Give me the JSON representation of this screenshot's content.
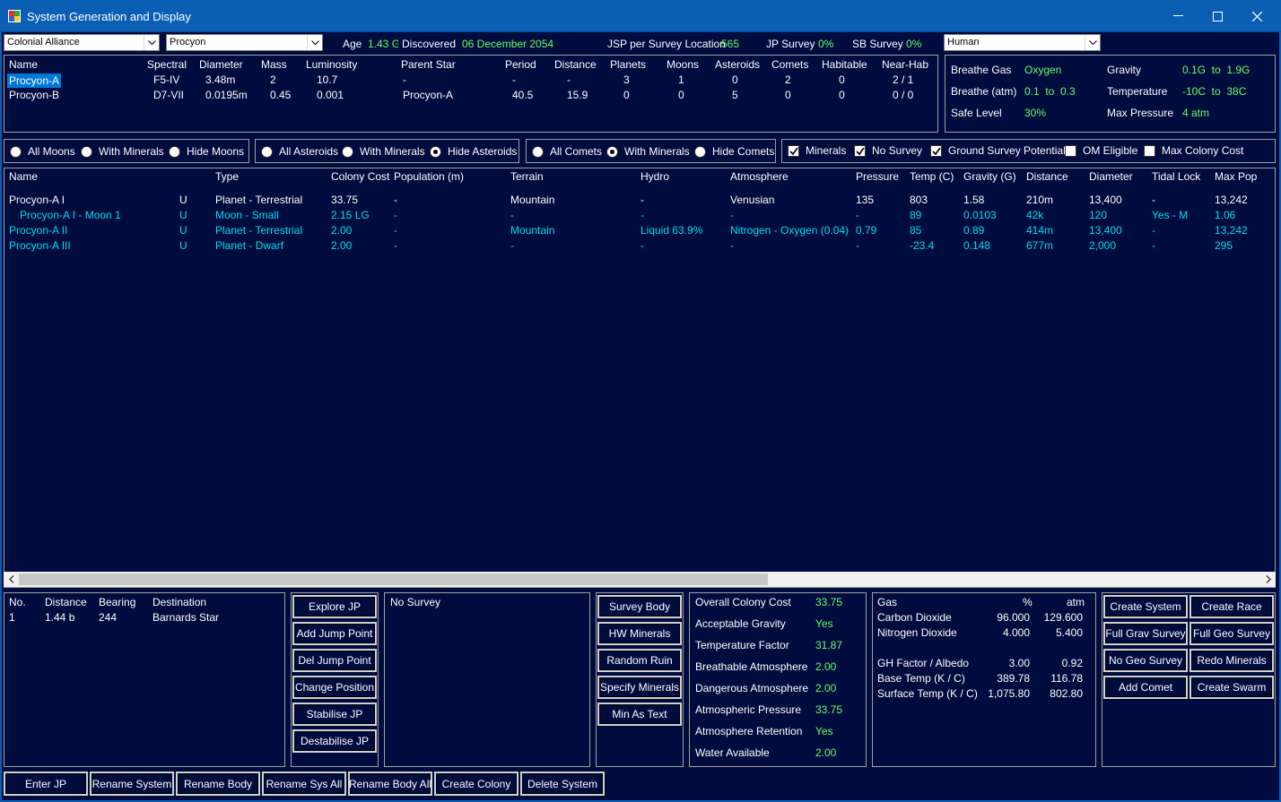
{
  "window": {
    "title": "System Generation and Display"
  },
  "top": {
    "empire": "Colonial Alliance",
    "system": "Procyon",
    "age_label": "Age",
    "age_value": "1.43 G",
    "discovered_label": "Discovered",
    "discovered_value": "06 December 2054",
    "jsp_label": "JSP per Survey Location",
    "jsp_value": "565",
    "jp_survey_label": "JP Survey",
    "jp_survey_value": "0%",
    "sb_survey_label": "SB Survey",
    "sb_survey_value": "0%",
    "race": "Human"
  },
  "stars": {
    "headers": [
      "Name",
      "Spectral",
      "Diameter",
      "Mass",
      "Luminosity",
      "Parent Star",
      "Period",
      "Distance",
      "Planets",
      "Moons",
      "Asteroids",
      "Comets",
      "Habitable",
      "Near-Hab"
    ],
    "rows": [
      [
        "Procyon-A",
        "F5-IV",
        "3.48m",
        "2",
        "10.7",
        "-",
        "-",
        "-",
        "3",
        "1",
        "0",
        "2",
        "0",
        "2 / 1"
      ],
      [
        "Procyon-B",
        "D7-VII",
        "0.0195m",
        "0.45",
        "0.001",
        "Procyon-A",
        "40.5",
        "15.9",
        "0",
        "0",
        "5",
        "0",
        "0",
        "0 / 0"
      ]
    ]
  },
  "env": {
    "breathe_gas_label": "Breathe Gas",
    "breathe_gas_value": "Oxygen",
    "gravity_label": "Gravity",
    "gravity_value": "0.1G  to  1.9G",
    "breathe_atm_label": "Breathe (atm)",
    "breathe_atm_value": "0.1  to  0.3",
    "temperature_label": "Temperature",
    "temperature_value": "-10C  to  38C",
    "safe_level_label": "Safe Level",
    "safe_level_value": "30%",
    "max_pressure_label": "Max Pressure",
    "max_pressure_value": "4 atm"
  },
  "filters": {
    "moons": [
      "All Moons",
      "With Minerals",
      "Hide Moons"
    ],
    "asteroids": [
      "All Asteroids",
      "With Minerals",
      "Hide Asteroids"
    ],
    "comets": [
      "All Comets",
      "With Minerals",
      "Hide Comets"
    ],
    "checks": [
      "Minerals",
      "No Survey",
      "Ground Survey Potential",
      "OM Eligible",
      "Max Colony Cost"
    ]
  },
  "bodies": {
    "headers": [
      "Name",
      "Type",
      "Colony Cost",
      "Population (m)",
      "Terrain",
      "Hydro",
      "Atmosphere",
      "Pressure",
      "Temp (C)",
      "Gravity (G)",
      "Distance",
      "Diameter",
      "Tidal Lock",
      "Max Pop"
    ],
    "rows": [
      {
        "name": "Procyon-A I",
        "flag": "U",
        "type": "Planet - Terrestrial",
        "cost": "33.75",
        "pop": "-",
        "terrain": "Mountain",
        "hydro": "-",
        "atmo": "Venusian",
        "pressure": "135",
        "temp": "803",
        "grav": "1.58",
        "dist": "210m",
        "diam": "13,400",
        "tidal": "-",
        "maxpop": "13,242"
      },
      {
        "name": "Procyon-A I - Moon 1",
        "flag": "U",
        "type": "Moon - Small",
        "cost": "2.15 LG",
        "pop": "-",
        "terrain": "-",
        "hydro": "-",
        "atmo": "-",
        "pressure": "-",
        "temp": "89",
        "grav": "0.0103",
        "dist": "42k",
        "diam": "120",
        "tidal": "Yes - M",
        "maxpop": "1.06"
      },
      {
        "name": "Procyon-A II",
        "flag": "U",
        "type": "Planet - Terrestrial",
        "cost": "2.00",
        "pop": "-",
        "terrain": "Mountain",
        "hydro": "Liquid 63.9%",
        "atmo": "Nitrogen - Oxygen (0.04)",
        "pressure": "0.79",
        "temp": "85",
        "grav": "0.89",
        "dist": "414m",
        "diam": "13,400",
        "tidal": "-",
        "maxpop": "13,242"
      },
      {
        "name": "Procyon-A III",
        "flag": "U",
        "type": "Planet - Dwarf",
        "cost": "2.00",
        "pop": "-",
        "terrain": "-",
        "hydro": "-",
        "atmo": "-",
        "pressure": "-",
        "temp": "-23.4",
        "grav": "0.148",
        "dist": "677m",
        "diam": "2,000",
        "tidal": "-",
        "maxpop": "295"
      }
    ]
  },
  "jump": {
    "headers": [
      "No.",
      "Distance",
      "Bearing",
      "Destination"
    ],
    "rows": [
      [
        "1",
        "1.44 b",
        "244",
        "Barnards Star"
      ]
    ]
  },
  "jp_buttons": [
    "Explore JP",
    "Add Jump Point",
    "Del Jump Point",
    "Change Position",
    "Stabilise JP",
    "Destabilise JP"
  ],
  "survey_status": "No Survey",
  "survey_buttons": [
    "Survey Body",
    "HW Minerals",
    "Random Ruin",
    "Specify Minerals",
    "Min As Text"
  ],
  "colony_cost": [
    {
      "label": "Overall Colony Cost",
      "value": "33.75"
    },
    {
      "label": "Acceptable Gravity",
      "value": "Yes"
    },
    {
      "label": "Temperature Factor",
      "value": "31.87"
    },
    {
      "label": "Breathable Atmosphere",
      "value": "2.00"
    },
    {
      "label": "Dangerous Atmosphere",
      "value": "2.00"
    },
    {
      "label": "Atmospheric Pressure",
      "value": "33.75"
    },
    {
      "label": "Atmosphere Retention",
      "value": "Yes"
    },
    {
      "label": "Water Available",
      "value": "2.00"
    }
  ],
  "gas": {
    "headers": [
      "Gas",
      "%",
      "atm"
    ],
    "rows": [
      [
        "Carbon Dioxide",
        "96.000",
        "129.600"
      ],
      [
        "Nitrogen Dioxide",
        "4.000",
        "5.400"
      ]
    ],
    "extra": [
      [
        "GH Factor / Albedo",
        "3.00",
        "0.92"
      ],
      [
        "Base Temp (K / C)",
        "389.78",
        "116.78"
      ],
      [
        "Surface Temp (K / C)",
        "1,075.80",
        "802.80"
      ]
    ]
  },
  "right_buttons": [
    "Create System",
    "Create Race",
    "Full Grav Survey",
    "Full Geo Survey",
    "No Geo Survey",
    "Redo Minerals",
    "Add Comet",
    "Create Swarm"
  ],
  "bottom_buttons": [
    "Enter JP",
    "Rename System",
    "Rename Body",
    "Rename Sys All",
    "Rename Body All",
    "Create Colony",
    "Delete System"
  ]
}
